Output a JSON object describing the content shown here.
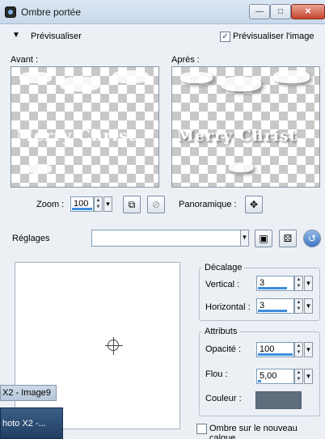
{
  "window": {
    "title": "Ombre portée",
    "min_glyph": "—",
    "max_glyph": "□",
    "close_glyph": "✕"
  },
  "preview": {
    "toggle_glyph": "▼",
    "label": "Prévisualiser",
    "checkbox_label": "Prévisualiser l'image",
    "checkbox_checked": true,
    "before_label": "Avant :",
    "after_label": "Après :",
    "image_text": "Merry Christ"
  },
  "zoom": {
    "label": "Zoom :",
    "value": "100"
  },
  "pan": {
    "label": "Panoramique :"
  },
  "settings": {
    "label": "Réglages",
    "value": ""
  },
  "offset": {
    "title": "Décalage",
    "vertical_label": "Vertical :",
    "vertical_value": "3",
    "horizontal_label": "Horizontal :",
    "horizontal_value": "3"
  },
  "attributes": {
    "title": "Attributs",
    "opacity_label": "Opacité :",
    "opacity_value": "100",
    "blur_label": "Flou :",
    "blur_value": "5,00",
    "color_label": "Couleur :",
    "color_hex": "#5d6e7d"
  },
  "new_layer": {
    "label": "Ombre sur le nouveau calque",
    "checked": false
  },
  "background_windows": {
    "first_title": "X2 - Image9",
    "second_title": "hoto X2 -..."
  },
  "icons": {
    "expand": "triangle-down-icon",
    "save": "floppy-disk-icon",
    "random": "dice-icon",
    "reset": "refresh-icon",
    "pan": "move-arrows-icon",
    "zoom_fit": "zoom-fit-icon",
    "zoom_disabled": "zoom-cancel-icon"
  }
}
